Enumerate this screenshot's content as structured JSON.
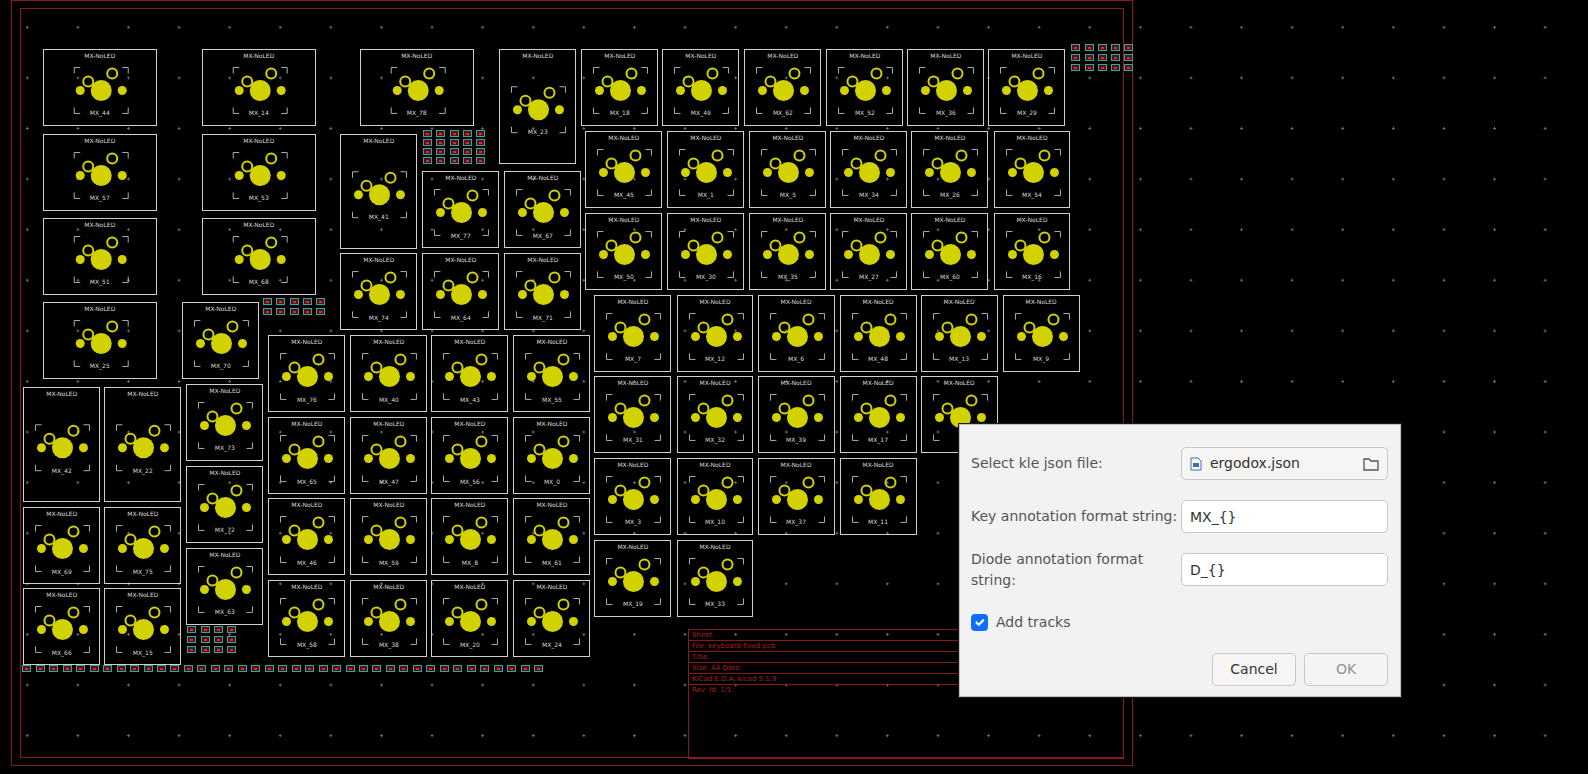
{
  "canvas": {
    "keys": [
      {
        "label": "MX-NoLED",
        "ref": "MX_44"
      },
      {
        "label": "MX-NoLED",
        "ref": "MX_57"
      },
      {
        "label": "MX-NoLED",
        "ref": "MX_51"
      },
      {
        "label": "MX-NoLED",
        "ref": "MX_25"
      },
      {
        "label": "MX-NoLED",
        "ref": "MX_14"
      },
      {
        "label": "MX-NoLED",
        "ref": "MX_53"
      },
      {
        "label": "MX-NoLED",
        "ref": "MX_68"
      },
      {
        "label": "MX-NoLED",
        "ref": "MX_70"
      },
      {
        "label": "MX-NoLED",
        "ref": "MX_78"
      },
      {
        "label": "MX-NoLED",
        "ref": "MX_23"
      },
      {
        "label": "MX-NoLED",
        "ref": "MX_18"
      },
      {
        "label": "MX-NoLED",
        "ref": "MX_49"
      },
      {
        "label": "MX-NoLED",
        "ref": "MX_62"
      },
      {
        "label": "MX-NoLED",
        "ref": "MX_52"
      },
      {
        "label": "MX-NoLED",
        "ref": "MX_36"
      },
      {
        "label": "MX-NoLED",
        "ref": "MX_29"
      },
      {
        "label": "MX-NoLED",
        "ref": "MX_45"
      },
      {
        "label": "MX-NoLED",
        "ref": "MX_1"
      },
      {
        "label": "MX-NoLED",
        "ref": "MX_5"
      },
      {
        "label": "MX-NoLED",
        "ref": "MX_34"
      },
      {
        "label": "MX-NoLED",
        "ref": "MX_26"
      },
      {
        "label": "MX-NoLED",
        "ref": "MX_54"
      },
      {
        "label": "MX-NoLED",
        "ref": "MX_50"
      },
      {
        "label": "MX-NoLED",
        "ref": "MX_30"
      },
      {
        "label": "MX-NoLED",
        "ref": "MX_35"
      },
      {
        "label": "MX-NoLED",
        "ref": "MX_27"
      },
      {
        "label": "MX-NoLED",
        "ref": "MX_60"
      },
      {
        "label": "MX-NoLED",
        "ref": "MX_16"
      },
      {
        "label": "MX-NoLED",
        "ref": "MX_7"
      },
      {
        "label": "MX-NoLED",
        "ref": "MX_12"
      },
      {
        "label": "MX-NoLED",
        "ref": "MX_6"
      },
      {
        "label": "MX-NoLED",
        "ref": "MX_48"
      },
      {
        "label": "MX-NoLED",
        "ref": "MX_13"
      },
      {
        "label": "MX-NoLED",
        "ref": "MX_9"
      },
      {
        "label": "MX-NoLED",
        "ref": "MX_31"
      },
      {
        "label": "MX-NoLED",
        "ref": "MX_32"
      },
      {
        "label": "MX-NoLED",
        "ref": "MX_39"
      },
      {
        "label": "MX-NoLED",
        "ref": "MX_17"
      },
      {
        "label": "MX-NoLED"
      },
      {
        "label": "MX-NoLED",
        "ref": "MX_3"
      },
      {
        "label": "MX-NoLED",
        "ref": "MX_10"
      },
      {
        "label": "MX-NoLED",
        "ref": "MX_37"
      },
      {
        "label": "MX-NoLED",
        "ref": "MX_11"
      },
      {
        "label": "MX-NoLED",
        "ref": "MX_19"
      },
      {
        "label": "MX-NoLED",
        "ref": "MX_33"
      },
      {
        "label": "MX-NoLED",
        "ref": "MX_41"
      },
      {
        "label": "MX-NoLED",
        "ref": "MX_74"
      },
      {
        "label": "MX-NoLED",
        "ref": "MX_77"
      },
      {
        "label": "MX-NoLED",
        "ref": "MX_67"
      },
      {
        "label": "MX-NoLED",
        "ref": "MX_64"
      },
      {
        "label": "MX-NoLED",
        "ref": "MX_71"
      },
      {
        "label": "MX-NoLED",
        "ref": "MX_76"
      },
      {
        "label": "MX-NoLED",
        "ref": "MX_65"
      },
      {
        "label": "MX-NoLED",
        "ref": "MX_46"
      },
      {
        "label": "MX-NoLED",
        "ref": "MX_58"
      },
      {
        "label": "MX-NoLED",
        "ref": "MX_40"
      },
      {
        "label": "MX-NoLED",
        "ref": "MX_47"
      },
      {
        "label": "MX-NoLED",
        "ref": "MX_59"
      },
      {
        "label": "MX-NoLED",
        "ref": "MX_38"
      },
      {
        "label": "MX-NoLED",
        "ref": "MX_43"
      },
      {
        "label": "MX-NoLED",
        "ref": "MX_56"
      },
      {
        "label": "MX-NoLED",
        "ref": "MX_8"
      },
      {
        "label": "MX-NoLED",
        "ref": "MX_20"
      },
      {
        "label": "MX-NoLED",
        "ref": "MX_55"
      },
      {
        "label": "MX-NoLED",
        "ref": "MX_0"
      },
      {
        "label": "MX-NoLED",
        "ref": "MX_61"
      },
      {
        "label": "MX-NoLED",
        "ref": "MX_24"
      },
      {
        "label": "MX-NoLED",
        "ref": "MX_73"
      },
      {
        "label": "MX-NoLED",
        "ref": "MX_72"
      },
      {
        "label": "MX-NoLED",
        "ref": "MX_63"
      },
      {
        "label": "MX-NoLED",
        "ref": "MX_42"
      },
      {
        "label": "MX-NoLED",
        "ref": "MX_22"
      },
      {
        "label": "MX-NoLED",
        "ref": "MX_69"
      },
      {
        "label": "MX-NoLED",
        "ref": "MX_66"
      },
      {
        "label": "MX-NoLED",
        "ref": "MX_75"
      },
      {
        "label": "MX-NoLED",
        "ref": "MX_15"
      }
    ]
  },
  "title_block": {
    "rows": [
      "Sheet:",
      "File: keyboard-fixed.pcb",
      "Title:",
      "Size: A4     Date:",
      "KiCad E.D.A.  kicad 5.1.9",
      "Rev:     Id: 1/1"
    ]
  },
  "dialog": {
    "file": {
      "label": "Select kle json file:",
      "value": "ergodox.json"
    },
    "key_format": {
      "label": "Key annotation format string:",
      "value": "MX_{}"
    },
    "diode_format": {
      "label": "Diode annotation format string:",
      "value": "D_{}"
    },
    "add_tracks": {
      "label": "Add tracks",
      "checked": true
    },
    "buttons": [
      {
        "label": "Cancel",
        "disabled": false
      },
      {
        "label": "OK",
        "disabled": true
      }
    ]
  }
}
